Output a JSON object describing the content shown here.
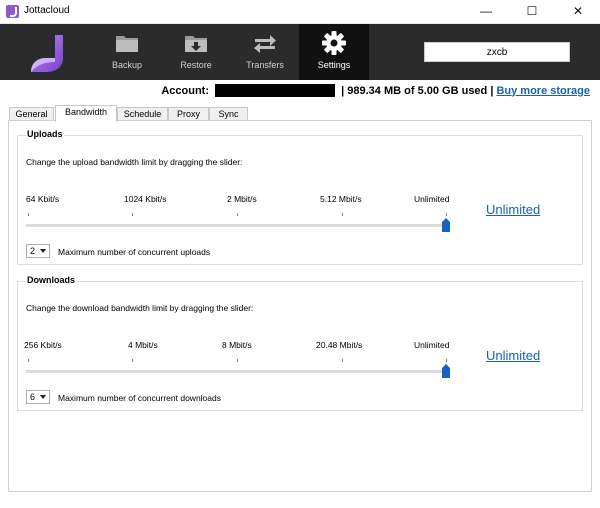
{
  "window": {
    "title": "Jottacloud",
    "minimize_glyph": "—",
    "maximize_glyph": "☐",
    "close_glyph": "✕"
  },
  "toolbar": {
    "logo_icon": "jottacloud-logo-icon",
    "items": [
      {
        "label": "Backup",
        "icon": "folder-icon"
      },
      {
        "label": "Restore",
        "icon": "download-icon"
      },
      {
        "label": "Transfers",
        "icon": "transfer-arrows-icon"
      },
      {
        "label": "Settings",
        "icon": "gear-icon",
        "active": true
      }
    ],
    "search_value": "zxcb"
  },
  "account": {
    "label": "Account:",
    "usage": "| 989.34 MB of 5.00 GB used |",
    "buy_link": "Buy more storage"
  },
  "tabs": [
    "General",
    "Bandwidth",
    "Schedule",
    "Proxy",
    "Sync"
  ],
  "active_tab": "Bandwidth",
  "uploads": {
    "title": "Uploads",
    "description": "Change the upload bandwidth limit by dragging the slider:",
    "ticks": [
      "64 Kbit/s",
      "1024 Kbit/s",
      "2 Mbit/s",
      "5.12 Mbit/s",
      "Unlimited"
    ],
    "slider_value": "Unlimited",
    "current_link": "Unlimited",
    "concurrent_value": "2",
    "concurrent_label": "Maximum number of concurrent uploads"
  },
  "downloads": {
    "title": "Downloads",
    "description": "Change the download bandwidth limit by dragging the slider:",
    "ticks": [
      "256 Kbit/s",
      "4 Mbit/s",
      "8 Mbit/s",
      "20.48 Mbit/s",
      "Unlimited"
    ],
    "slider_value": "Unlimited",
    "current_link": "Unlimited",
    "concurrent_value": "6",
    "concurrent_label": "Maximum number of concurrent downloads"
  },
  "colors": {
    "toolbar_bg": "#2b2b2b",
    "active_tool_bg": "#111111",
    "slider_thumb": "#1565c0",
    "link": "#1a5fb4",
    "logo_purple": "#8b5bd0"
  }
}
